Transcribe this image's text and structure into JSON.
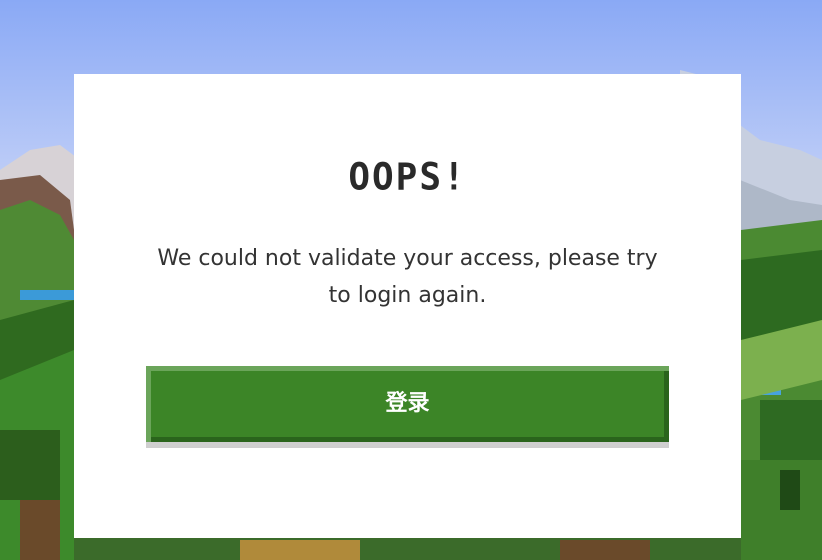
{
  "dialog": {
    "title": "OOPS!",
    "message": "We could not validate your access, please try to login again.",
    "login_button_label": "登录"
  },
  "colors": {
    "button": "#3c8527",
    "button_highlight": "#6ba55a",
    "button_shade": "#2a641c",
    "modal_bg": "#ffffff",
    "text": "#333333"
  }
}
